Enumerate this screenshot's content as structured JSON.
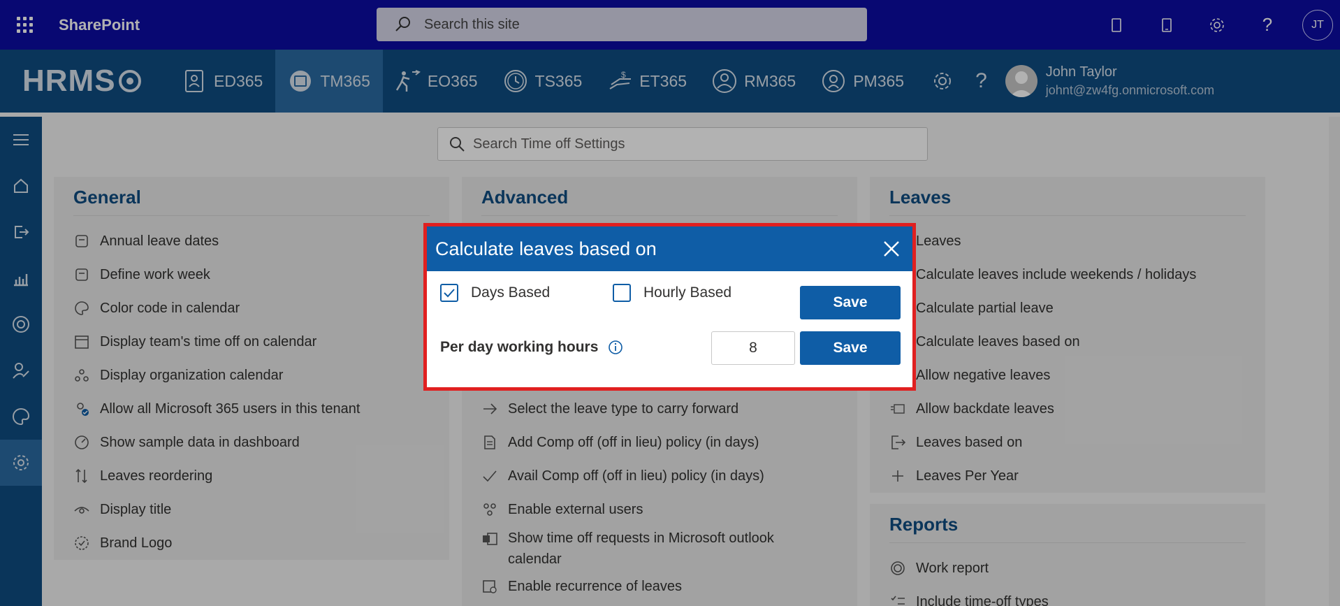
{
  "sharepoint": {
    "title": "SharePoint",
    "search_placeholder": "Search this site",
    "avatar_initials": "JT"
  },
  "hrms": {
    "logo": "HRMS",
    "nav": [
      {
        "label": "ED365",
        "icon": "id-card-icon"
      },
      {
        "label": "TM365",
        "icon": "calendar-icon",
        "active": true
      },
      {
        "label": "EO365",
        "icon": "exit-person-icon"
      },
      {
        "label": "TS365",
        "icon": "clock-icon"
      },
      {
        "label": "ET365",
        "icon": "money-icon"
      },
      {
        "label": "RM365",
        "icon": "recruit-icon"
      },
      {
        "label": "PM365",
        "icon": "performance-icon"
      }
    ],
    "user": {
      "name": "John Taylor",
      "email": "johnt@zw4fg.onmicrosoft.com"
    }
  },
  "content_search": {
    "placeholder": "Search Time off Settings"
  },
  "general": {
    "title": "General",
    "items": [
      "Annual leave dates",
      "Define work week",
      "Color code in calendar",
      "Display team's time off on calendar",
      "Display organization calendar",
      "Allow all Microsoft 365 users in this tenant",
      "Show sample data in dashboard",
      "Leaves reordering",
      "Display title",
      "Brand Logo"
    ]
  },
  "advanced": {
    "title": "Advanced",
    "items": [
      "Select the leave type to carry forward",
      "Add Comp off (off in lieu) policy (in days)",
      "Avail Comp off (off in lieu) policy (in days)",
      "Enable external users",
      "Show time off requests in Microsoft outlook calendar",
      "Enable recurrence of leaves"
    ]
  },
  "leaves": {
    "title": "Leaves",
    "items": [
      "Leaves",
      "Calculate leaves include weekends / holidays",
      "Calculate partial leave",
      "Calculate leaves based on",
      "Allow negative leaves",
      "Allow backdate leaves",
      "Leaves based on",
      "Leaves Per Year"
    ]
  },
  "reports": {
    "title": "Reports",
    "items": [
      "Work report",
      "Include time-off types"
    ]
  },
  "modal": {
    "title": "Calculate leaves based on",
    "days_based_label": "Days Based",
    "days_based_checked": true,
    "hourly_based_label": "Hourly Based",
    "hourly_based_checked": false,
    "save_label": "Save",
    "hours_label": "Per day working hours",
    "hours_value": "8",
    "save2_label": "Save"
  },
  "colors": {
    "sp_bar": "#0c0ca4",
    "hrms_bar": "#0f4c81",
    "accent": "#0f5da6",
    "modal_border": "#e02020"
  }
}
